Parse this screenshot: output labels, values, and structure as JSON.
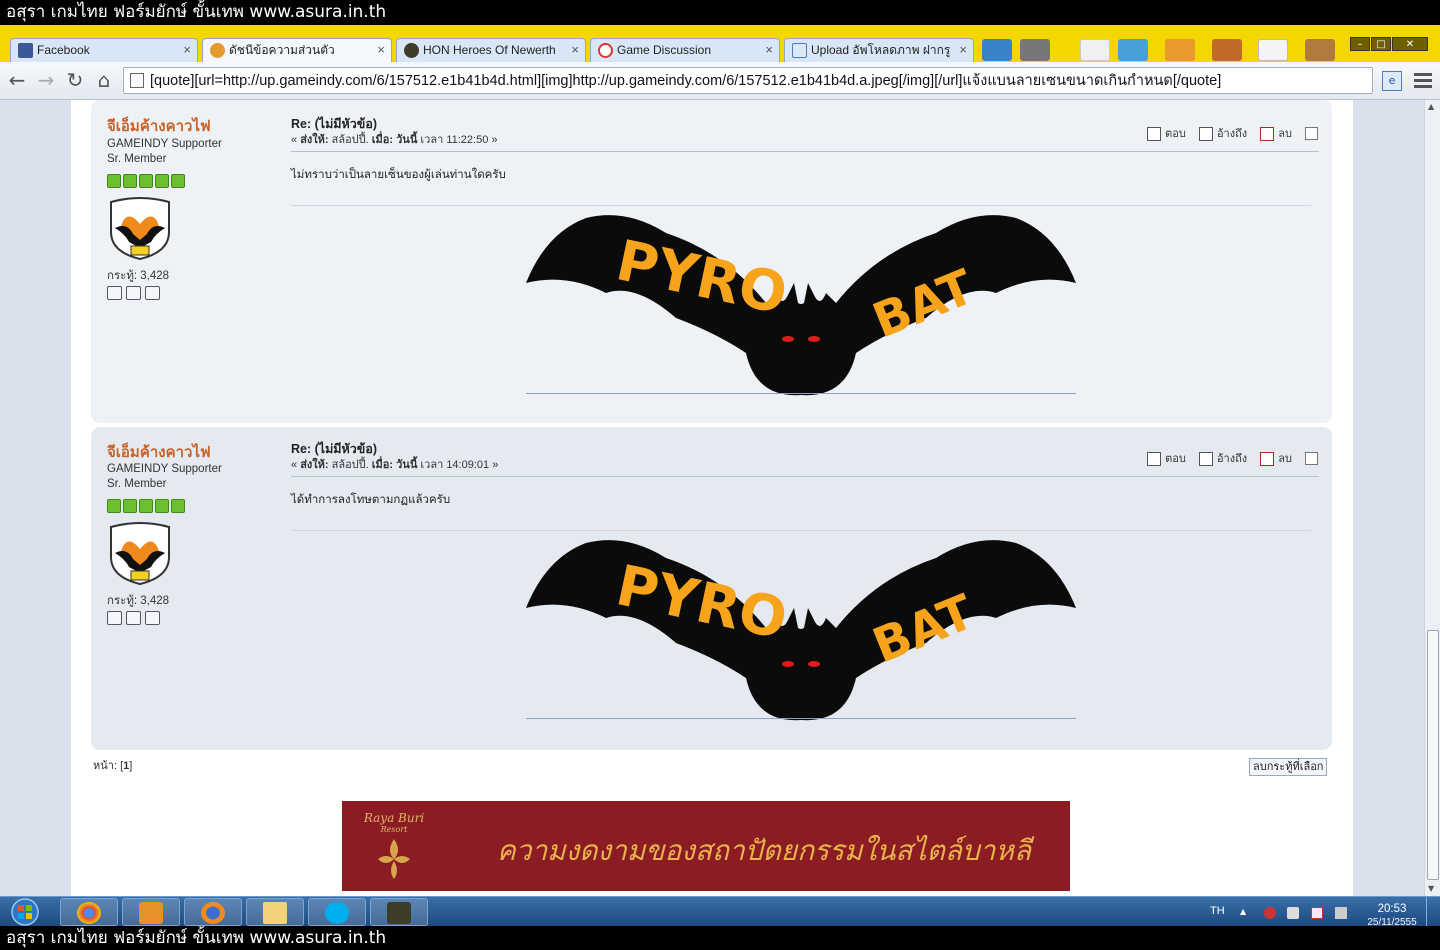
{
  "banner": {
    "top_text": "อสุรา เกมไทย ฟอร์มยักษ์ ขั้นเทพ www.asura.in.th",
    "bottom_text": "อสุรา เกมไทย ฟอร์มยักษ์ ขั้นเทพ www.asura.in.th"
  },
  "browser": {
    "tabs": [
      {
        "label": "Facebook",
        "icon": "facebook-icon",
        "active": false
      },
      {
        "label": "ดัชนีข้อความส่วนตัว",
        "icon": "forum-icon",
        "active": true
      },
      {
        "label": "HON Heroes Of Newerth",
        "icon": "hon-icon",
        "active": false
      },
      {
        "label": "Game Discussion",
        "icon": "game-discussion-icon",
        "active": false
      },
      {
        "label": "Upload อัพโหลดภาพ ฝากรูป",
        "icon": "gameindy-icon",
        "active": false
      }
    ],
    "address": "[quote][url=http://up.gameindy.com/6/157512.e1b41b4d.html][img]http://up.gameindy.com/6/157512.e1b41b4d.a.jpeg[/img][/url]แจ้งแบนลายเซนขนาดเกินกำหนด[/quote]",
    "tab_close": "×",
    "nav": {
      "back": "←",
      "forward": "→",
      "reload": "↻",
      "home": "⌂"
    }
  },
  "forum": {
    "posts": [
      {
        "poster": {
          "name": "จีเอ็มค้างคาวไฟ",
          "group": "GAMEINDY Supporter",
          "rank": "Sr. Member",
          "stars": 5,
          "posts_label": "กระทู้: 3,428"
        },
        "subject": "Re: (ไม่มีหัวข้อ)",
        "meta_prefix": "« ",
        "sent_to_label": "ส่งให้:",
        "sent_to": "สล้อปปี้.",
        "when_label": "เมื่อ:",
        "when_day": "วันนี้",
        "when_time": "เวลา 11:22:50",
        "meta_suffix": " »",
        "body": "ไม่ทราบว่าเป็นลายเซ็นของผู้เล่นท่านใดครับ",
        "signature_image": "PYRO BAT"
      },
      {
        "poster": {
          "name": "จีเอ็มค้างคาวไฟ",
          "group": "GAMEINDY Supporter",
          "rank": "Sr. Member",
          "stars": 5,
          "posts_label": "กระทู้: 3,428"
        },
        "subject": "Re: (ไม่มีหัวข้อ)",
        "meta_prefix": "« ",
        "sent_to_label": "ส่งให้:",
        "sent_to": "สล้อปปี้.",
        "when_label": "เมื่อ:",
        "when_day": "วันนี้",
        "when_time": "เวลา 14:09:01",
        "meta_suffix": " »",
        "body": "ได้ทำการลงโทษตามกฏแล้วครับ",
        "signature_image": "PYRO BAT"
      }
    ],
    "actions": {
      "reply": "ตอบ",
      "quote": "อ้างถึง",
      "delete": "ลบ"
    },
    "pager": {
      "label": "หน้า:",
      "current": "1"
    },
    "delete_selected": "ลบกระทู้ที่เลือก"
  },
  "ad": {
    "brand": "Raya Buri",
    "brand_sub": "Resort",
    "text": "ความงดงามของสถาปัตยกรรมในสไตล์บาหลี"
  },
  "taskbar": {
    "lang": "TH",
    "time": "20:53",
    "date": "25/11/2555"
  },
  "colors": {
    "accent_yellow": "#f4d600",
    "poster_name": "#c8632a",
    "star_green": "#6cbf2f",
    "ad_bg": "#8b1c24",
    "ad_text": "#e8b24a"
  }
}
